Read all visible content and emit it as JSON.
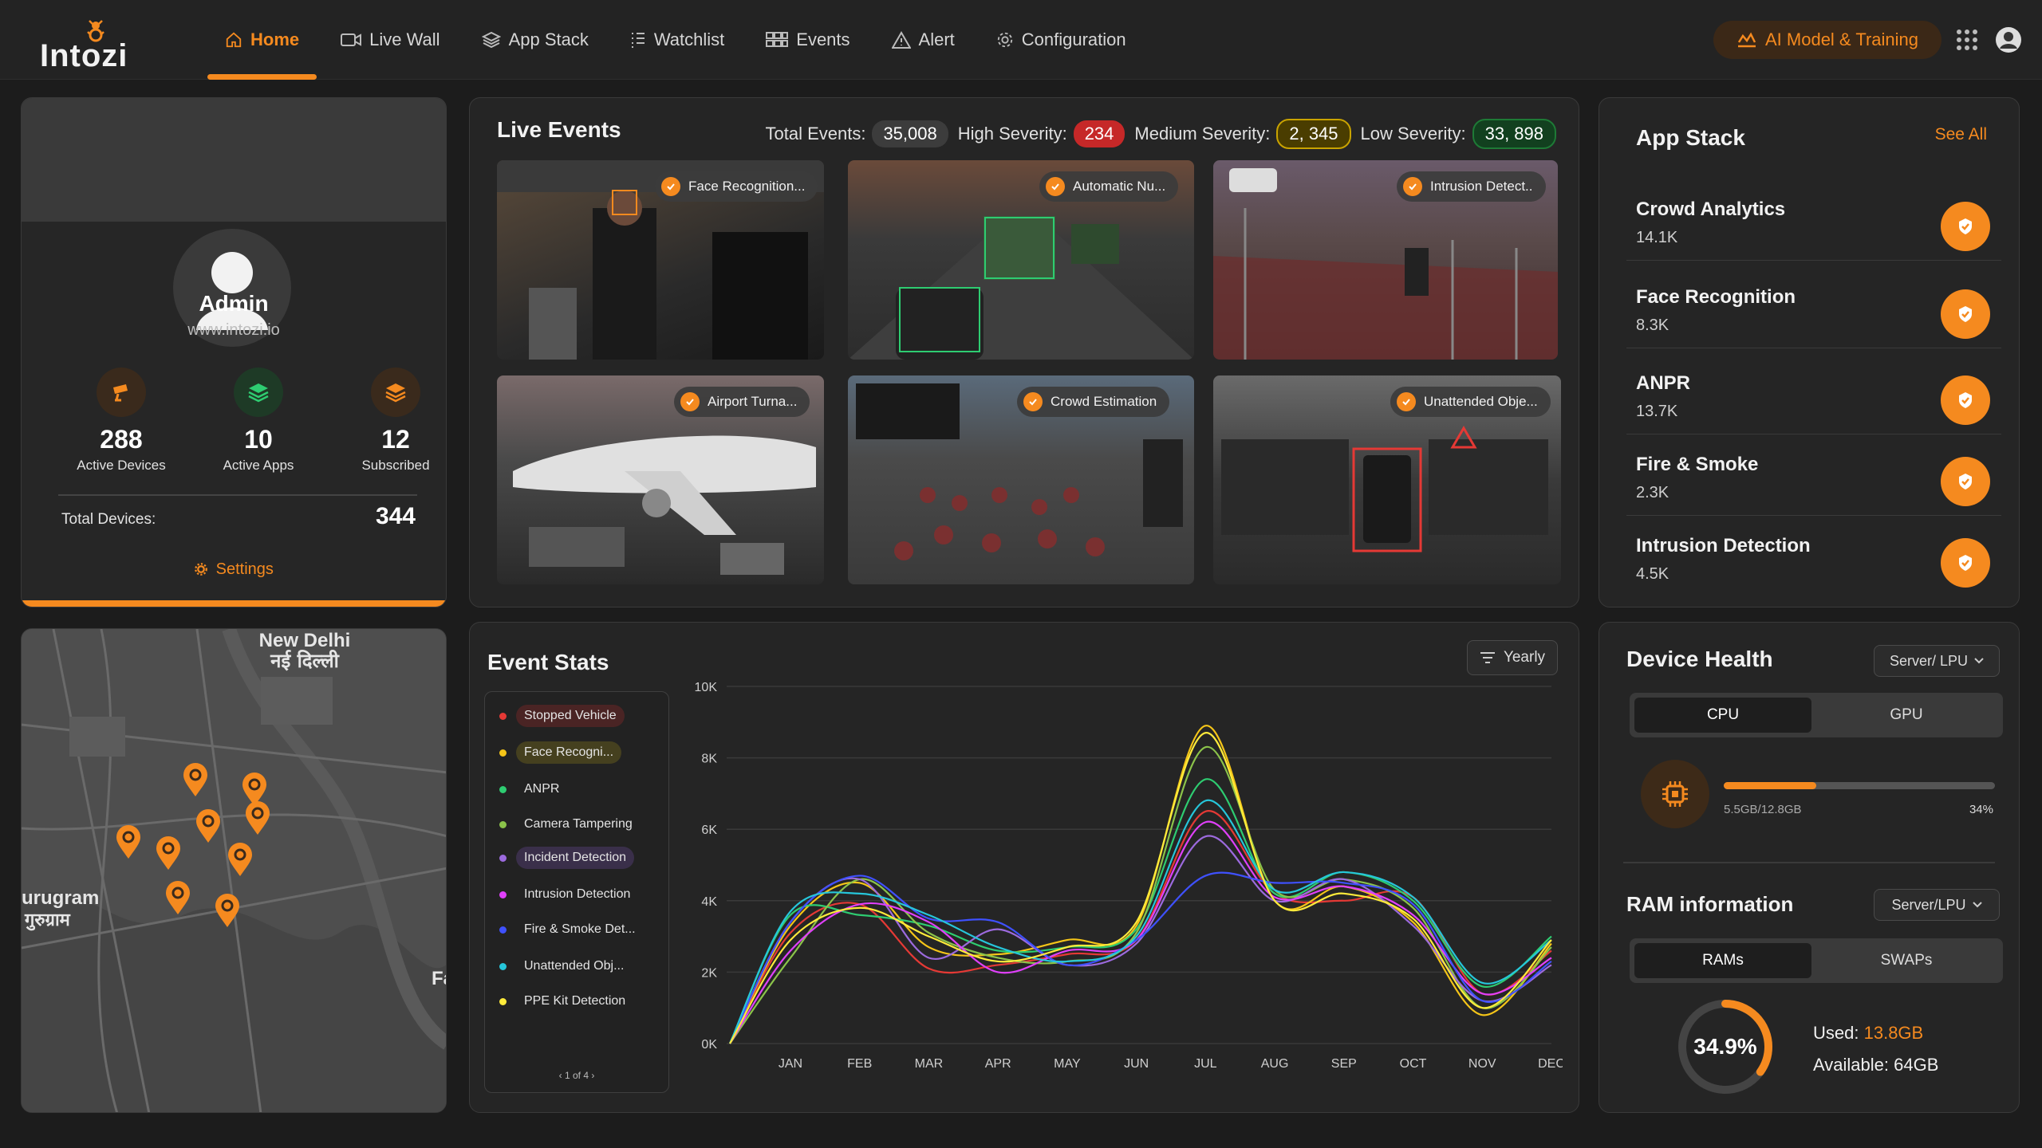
{
  "app": {
    "logo_text": "Intozi"
  },
  "nav": [
    {
      "label": "Home",
      "icon": "home-icon",
      "active": true
    },
    {
      "label": "Live Wall",
      "icon": "video-icon"
    },
    {
      "label": "App Stack",
      "icon": "layers-icon"
    },
    {
      "label": "Watchlist",
      "icon": "list-icon"
    },
    {
      "label": "Events",
      "icon": "grid-icon"
    },
    {
      "label": "Alert",
      "icon": "warning-icon"
    },
    {
      "label": "Configuration",
      "icon": "gear-icon"
    }
  ],
  "header": {
    "ai_button": "AI Model & Training"
  },
  "profile": {
    "name": "Admin",
    "site": "www.intozi.io",
    "stats": [
      {
        "value": "288",
        "label": "Active Devices",
        "icon": "camera-icon",
        "color": "#f58a1f"
      },
      {
        "value": "10",
        "label": "Active Apps",
        "icon": "stack-icon",
        "color": "#2ecc71"
      },
      {
        "value": "12",
        "label": "Subscribed",
        "icon": "layers-icon",
        "color": "#f58a1f"
      }
    ],
    "total_label": "Total Devices:",
    "total_value": "344",
    "settings_label": "Settings"
  },
  "map": {
    "label_en": "New Delhi",
    "label_hi": "नई दिल्ली",
    "left_en": "urugram",
    "left_hi": "गुरुग्राम",
    "right_en": "Fa"
  },
  "live_events": {
    "title": "Live Events",
    "total_label": "Total Events:",
    "total_value": "35,008",
    "high_label": "High Severity:",
    "high_value": "234",
    "medium_label": "Medium Severity:",
    "medium_value": "2, 345",
    "low_label": "Low Severity:",
    "low_value": "33, 898",
    "thumbs": [
      {
        "tag": "Face Recognition..."
      },
      {
        "tag": "Automatic Nu..."
      },
      {
        "tag": "Intrusion Detect.."
      },
      {
        "tag": "Airport Turna..."
      },
      {
        "tag": "Crowd Estimation"
      },
      {
        "tag": "Unattended Obje..."
      }
    ]
  },
  "app_stack": {
    "title": "App Stack",
    "see_all": "See All",
    "items": [
      {
        "name": "Crowd Analytics",
        "value": "14.1K"
      },
      {
        "name": "Face Recognition",
        "value": "8.3K"
      },
      {
        "name": "ANPR",
        "value": "13.7K"
      },
      {
        "name": "Fire & Smoke",
        "value": "2.3K"
      },
      {
        "name": "Intrusion Detection",
        "value": "4.5K"
      }
    ]
  },
  "event_stats": {
    "title": "Event Stats",
    "filter": "Yearly",
    "legend": [
      {
        "label": "Stopped Vehicle",
        "color": "#e53935",
        "highlight": "#4a2424"
      },
      {
        "label": "Face Recogni...",
        "color": "#f5c518",
        "highlight": "#45401f"
      },
      {
        "label": "ANPR",
        "color": "#2ecc71"
      },
      {
        "label": "Camera Tampering",
        "color": "#8bc34a"
      },
      {
        "label": "Incident Detection",
        "color": "#9c6ade",
        "highlight": "#3a2f4a"
      },
      {
        "label": "Intrusion Detection",
        "color": "#e040fb"
      },
      {
        "label": "Fire & Smoke Det...",
        "color": "#3f51ff"
      },
      {
        "label": "Unattended Obj...",
        "color": "#26c6da"
      },
      {
        "label": "PPE Kit Detection",
        "color": "#ffeb3b"
      }
    ],
    "pagination": "1 of 4"
  },
  "chart_data": {
    "type": "line",
    "categories": [
      "JAN",
      "FEB",
      "MAR",
      "APR",
      "MAY",
      "JUN",
      "JUL",
      "AUG",
      "SEP",
      "OCT",
      "NOV",
      "DEC"
    ],
    "ylim": [
      0,
      10000
    ],
    "yticks": [
      "0K",
      "2K",
      "4K",
      "6K",
      "8K",
      "10K"
    ],
    "series": [
      {
        "name": "Stopped Vehicle",
        "color": "#e53935",
        "values": [
          3100,
          3900,
          2100,
          2200,
          2500,
          2900,
          6500,
          4200,
          4000,
          4100,
          1400,
          2600
        ]
      },
      {
        "name": "Face Recogni...",
        "color": "#f5c518",
        "values": [
          3300,
          4500,
          2700,
          2500,
          2900,
          3300,
          8900,
          4000,
          4400,
          3400,
          800,
          2800
        ]
      },
      {
        "name": "ANPR",
        "color": "#2ecc71",
        "values": [
          3600,
          3600,
          3300,
          2600,
          2700,
          3200,
          7400,
          4200,
          4800,
          4000,
          1600,
          3000
        ]
      },
      {
        "name": "Camera Tampering",
        "color": "#8bc34a",
        "values": [
          2400,
          4600,
          3100,
          2400,
          2300,
          3100,
          8300,
          4300,
          4600,
          3800,
          1000,
          2700
        ]
      },
      {
        "name": "Incident Detection",
        "color": "#9c6ade",
        "values": [
          3400,
          4600,
          2400,
          3200,
          2200,
          2800,
          5800,
          4000,
          4600,
          3300,
          1200,
          2200
        ]
      },
      {
        "name": "Intrusion Detection",
        "color": "#e040fb",
        "values": [
          2600,
          3900,
          3400,
          2000,
          2600,
          2900,
          6200,
          4100,
          4400,
          3600,
          1400,
          2400
        ]
      },
      {
        "name": "Fire & Smoke Det...",
        "color": "#3f51ff",
        "values": [
          3400,
          4700,
          3500,
          3400,
          2200,
          2900,
          4700,
          4500,
          4500,
          3900,
          1200,
          2300
        ]
      },
      {
        "name": "Unattended Obj...",
        "color": "#26c6da",
        "values": [
          3700,
          4200,
          3600,
          2700,
          2300,
          3000,
          6800,
          4300,
          4800,
          4100,
          1700,
          2900
        ]
      },
      {
        "name": "PPE Kit Detection",
        "color": "#ffeb3b",
        "values": [
          2900,
          3800,
          3000,
          2300,
          2700,
          3400,
          8700,
          4000,
          4200,
          3500,
          1000,
          2900
        ]
      }
    ],
    "grid": true
  },
  "device_health": {
    "title": "Device Health",
    "dropdown": "Server/ LPU",
    "tab_cpu": "CPU",
    "tab_gpu": "GPU",
    "cpu_usage_text": "5.5GB/12.8GB",
    "cpu_percent_text": "34%",
    "cpu_percent": 34,
    "ram_title": "RAM information",
    "ram_dropdown": "Server/LPU",
    "tab_rams": "RAMs",
    "tab_swaps": "SWAPs",
    "ram_percent_text": "34.9%",
    "ram_percent": 34.9,
    "used_label": "Used:",
    "used_value": "13.8GB",
    "available_label": "Available:",
    "available_value": "64GB"
  },
  "colors": {
    "accent": "#f58a1f",
    "background": "#1c1c1c",
    "panel": "#252525",
    "high": "#c62828",
    "medium": "#c9a300",
    "low": "#1e7a36"
  }
}
